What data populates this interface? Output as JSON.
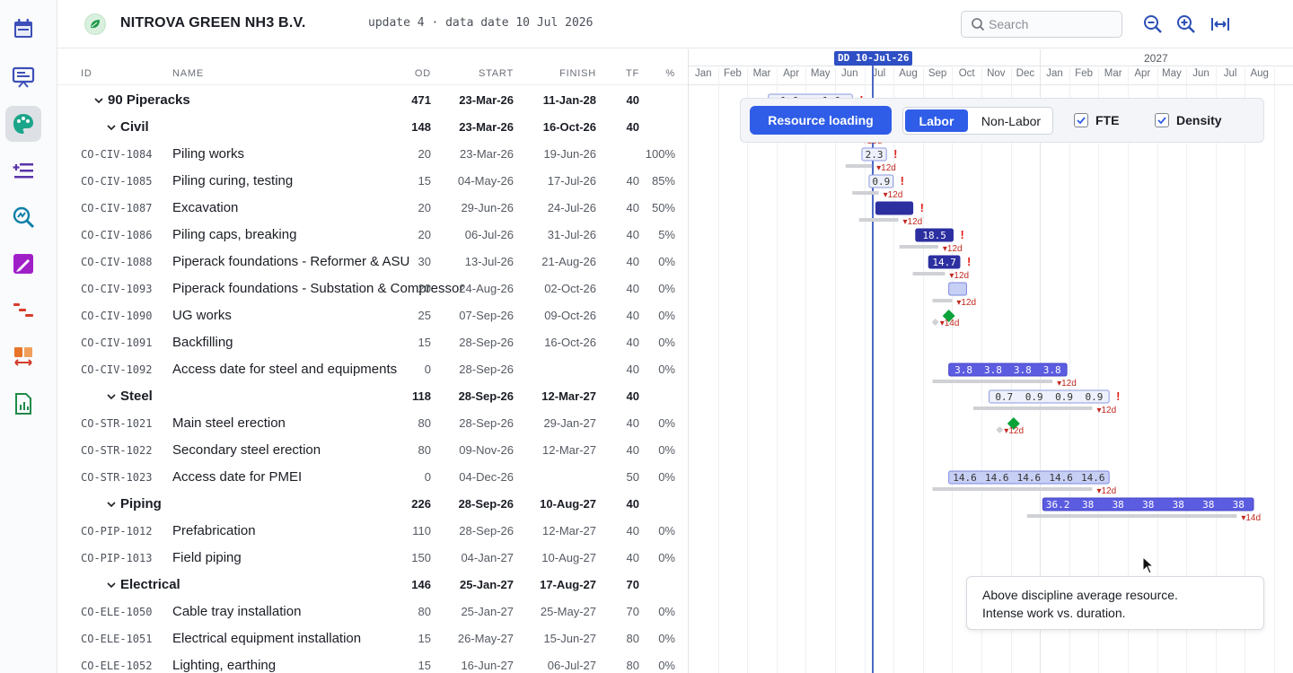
{
  "sidebar": {
    "items": [
      {
        "icon": "calendar-icon",
        "color": "#3d4fb8"
      },
      {
        "icon": "presentation-icon",
        "color": "#3d4fb8"
      },
      {
        "icon": "palette-icon",
        "color": "#1ba58a",
        "active": true
      },
      {
        "icon": "list-plus-icon",
        "color": "#5a34a8"
      },
      {
        "icon": "zoom-analysis-icon",
        "color": "#0f7fa8"
      },
      {
        "icon": "pen-icon",
        "color": "#a020c8"
      },
      {
        "icon": "bars-cascade-icon",
        "color": "#d63c2a"
      },
      {
        "icon": "swap-blocks-icon",
        "color": "#e8742a"
      },
      {
        "icon": "report-chart-icon",
        "color": "#1f8a4a"
      }
    ]
  },
  "header": {
    "company": "NITROVA GREEN NH3 B.V.",
    "update": "update 4 · data date 10 Jul 2026",
    "search_placeholder": "Search"
  },
  "table": {
    "columns": {
      "id": "ID",
      "name": "NAME",
      "od": "OD",
      "start": "START",
      "finish": "FINISH",
      "tf": "TF",
      "pct": "%"
    },
    "rows": [
      {
        "level": 0,
        "group": true,
        "id": "",
        "name": "90 Piperacks",
        "od": "471",
        "start": "23-Mar-26",
        "finish": "11-Jan-28",
        "tf": "40",
        "pct": ""
      },
      {
        "level": 1,
        "group": true,
        "id": "",
        "name": "Civil",
        "od": "148",
        "start": "23-Mar-26",
        "finish": "16-Oct-26",
        "tf": "40",
        "pct": ""
      },
      {
        "group": false,
        "id": "CO-CIV-1084",
        "name": "Piling works",
        "od": "20",
        "start": "23-Mar-26",
        "finish": "19-Jun-26",
        "tf": "",
        "pct": "100%"
      },
      {
        "group": false,
        "id": "CO-CIV-1085",
        "name": "Piling curing, testing",
        "od": "15",
        "start": "04-May-26",
        "finish": "17-Jul-26",
        "tf": "40",
        "pct": "85%"
      },
      {
        "group": false,
        "id": "CO-CIV-1087",
        "name": "Excavation",
        "od": "20",
        "start": "29-Jun-26",
        "finish": "24-Jul-26",
        "tf": "40",
        "pct": "50%"
      },
      {
        "group": false,
        "id": "CO-CIV-1086",
        "name": "Piling caps, breaking",
        "od": "20",
        "start": "06-Jul-26",
        "finish": "31-Jul-26",
        "tf": "40",
        "pct": "5%"
      },
      {
        "group": false,
        "id": "CO-CIV-1088",
        "name": "Piperack foundations - Reformer & ASU",
        "od": "30",
        "start": "13-Jul-26",
        "finish": "21-Aug-26",
        "tf": "40",
        "pct": "0%"
      },
      {
        "group": false,
        "id": "CO-CIV-1093",
        "name": "Piperack foundations - Substation & Compressor",
        "od": "20",
        "start": "24-Aug-26",
        "finish": "02-Oct-26",
        "tf": "40",
        "pct": "0%"
      },
      {
        "group": false,
        "id": "CO-CIV-1090",
        "name": "UG works",
        "od": "25",
        "start": "07-Sep-26",
        "finish": "09-Oct-26",
        "tf": "40",
        "pct": "0%"
      },
      {
        "group": false,
        "id": "CO-CIV-1091",
        "name": "Backfilling",
        "od": "15",
        "start": "28-Sep-26",
        "finish": "16-Oct-26",
        "tf": "40",
        "pct": "0%"
      },
      {
        "group": false,
        "id": "CO-CIV-1092",
        "name": "Access date for steel and equipments",
        "od": "0",
        "start": "28-Sep-26",
        "finish": "",
        "tf": "40",
        "pct": "0%"
      },
      {
        "level": 1,
        "group": true,
        "id": "",
        "name": "Steel",
        "od": "118",
        "start": "28-Sep-26",
        "finish": "12-Mar-27",
        "tf": "40",
        "pct": ""
      },
      {
        "group": false,
        "id": "CO-STR-1021",
        "name": "Main steel erection",
        "od": "80",
        "start": "28-Sep-26",
        "finish": "29-Jan-27",
        "tf": "40",
        "pct": "0%"
      },
      {
        "group": false,
        "id": "CO-STR-1022",
        "name": "Secondary steel erection",
        "od": "80",
        "start": "09-Nov-26",
        "finish": "12-Mar-27",
        "tf": "40",
        "pct": "0%"
      },
      {
        "group": false,
        "id": "CO-STR-1023",
        "name": "Access date for PMEI",
        "od": "0",
        "start": "04-Dec-26",
        "finish": "",
        "tf": "50",
        "pct": "0%"
      },
      {
        "level": 1,
        "group": true,
        "id": "",
        "name": "Piping",
        "od": "226",
        "start": "28-Sep-26",
        "finish": "10-Aug-27",
        "tf": "40",
        "pct": ""
      },
      {
        "group": false,
        "id": "CO-PIP-1012",
        "name": "Prefabrication",
        "od": "110",
        "start": "28-Sep-26",
        "finish": "12-Mar-27",
        "tf": "40",
        "pct": "0%"
      },
      {
        "group": false,
        "id": "CO-PIP-1013",
        "name": "Field piping",
        "od": "150",
        "start": "04-Jan-27",
        "finish": "10-Aug-27",
        "tf": "40",
        "pct": "0%"
      },
      {
        "level": 1,
        "group": true,
        "id": "",
        "name": "Electrical",
        "od": "146",
        "start": "25-Jan-27",
        "finish": "17-Aug-27",
        "tf": "70",
        "pct": ""
      },
      {
        "group": false,
        "id": "CO-ELE-1050",
        "name": "Cable tray installation",
        "od": "80",
        "start": "25-Jan-27",
        "finish": "25-May-27",
        "tf": "70",
        "pct": "0%"
      },
      {
        "group": false,
        "id": "CO-ELE-1051",
        "name": "Electrical equipment installation",
        "od": "15",
        "start": "26-May-27",
        "finish": "15-Jun-27",
        "tf": "80",
        "pct": "0%"
      },
      {
        "group": false,
        "id": "CO-ELE-1052",
        "name": "Lighting, earthing",
        "od": "15",
        "start": "16-Jun-27",
        "finish": "06-Jul-27",
        "tf": "80",
        "pct": "0%"
      }
    ]
  },
  "gantt": {
    "year_2026": "",
    "year_2027": "2027",
    "months": [
      "Jan",
      "Feb",
      "Mar",
      "Apr",
      "May",
      "Jun",
      "Jul",
      "Aug",
      "Sep",
      "Oct",
      "Nov",
      "Dec",
      "Jan",
      "Feb",
      "Mar",
      "Apr",
      "May",
      "Jun",
      "Jul",
      "Aug"
    ],
    "data_date_label": "DD 10-Jul-26",
    "toolbar": {
      "resource_loading": "Resource loading",
      "labor": "Labor",
      "non_labor": "Non-Labor",
      "fte": "FTE",
      "density": "Density",
      "fte_checked": true,
      "density_checked": true
    },
    "tooltip_line1": "Above discipline average resource.",
    "tooltip_line2": "Intense work vs. duration.",
    "colors": {
      "light": "#eef1fb",
      "mid": "#c7cff5",
      "dark": "#2c2fa0",
      "bright": "#5b5ce0",
      "done": "#0aa33a",
      "baseline": "#cfd1d5",
      "float": "#c0281f"
    },
    "bars": [
      {
        "start": "23-Mar-26",
        "finish": "19-Jun-26",
        "kind": "light",
        "labels": [
          "1.6",
          "1.6"
        ],
        "warn": true,
        "baseline_start": "04-May-26",
        "baseline_finish": "30-May-26",
        "float": "▾7d"
      },
      {
        "start": "04-May-26",
        "finish": "17-Jul-26",
        "kind": "done",
        "labels": [],
        "warn": false,
        "baseline_start": "05-Jun-26",
        "baseline_finish": "25-Jun-26",
        "float": "▾15d"
      },
      {
        "start": "29-Jun-26",
        "finish": "24-Jul-26",
        "kind": "light",
        "labels": [
          "2.3"
        ],
        "warn": true,
        "baseline_start": "12-Jun-26",
        "baseline_finish": "09-Jul-26",
        "float": "▾12d"
      },
      {
        "start": "06-Jul-26",
        "finish": "31-Jul-26",
        "kind": "light",
        "labels": [
          "0.9"
        ],
        "warn": true,
        "baseline_start": "19-Jun-26",
        "baseline_finish": "16-Jul-26",
        "float": "▾12d"
      },
      {
        "start": "13-Jul-26",
        "finish": "21-Aug-26",
        "kind": "dark",
        "labels": [],
        "warn": true,
        "baseline_start": "26-Jun-26",
        "baseline_finish": "06-Aug-26",
        "float": "▾12d"
      },
      {
        "start": "24-Aug-26",
        "finish": "02-Oct-26",
        "kind": "dark",
        "labels": [
          "18.5"
        ],
        "warn": true,
        "baseline_start": "07-Aug-26",
        "baseline_finish": "17-Sep-26",
        "float": "▾12d"
      },
      {
        "start": "07-Sep-26",
        "finish": "09-Oct-26",
        "kind": "dark",
        "labels": [
          "14.7"
        ],
        "warn": true,
        "baseline_start": "21-Aug-26",
        "baseline_finish": "24-Sep-26",
        "float": "▾12d"
      },
      {
        "start": "28-Sep-26",
        "finish": "16-Oct-26",
        "kind": "mid",
        "labels": [],
        "warn": false,
        "baseline_start": "11-Sep-26",
        "baseline_finish": "01-Oct-26",
        "float": "▾12d"
      },
      {
        "start": "28-Sep-26",
        "finish": "",
        "kind": "milestone",
        "labels": [],
        "warn": false,
        "baseline_start": "14-Sep-26",
        "baseline_finish": "",
        "float": "▾14d"
      },
      null,
      {
        "start": "28-Sep-26",
        "finish": "29-Jan-27",
        "kind": "bright",
        "labels": [
          "3.8",
          "3.8",
          "3.8",
          "3.8"
        ],
        "warn": false,
        "baseline_start": "11-Sep-26",
        "baseline_finish": "14-Jan-27",
        "float": "▾12d"
      },
      {
        "start": "09-Nov-26",
        "finish": "12-Mar-27",
        "kind": "light",
        "labels": [
          "0.7",
          "0.9",
          "0.9",
          "0.9"
        ],
        "warn": true,
        "baseline_start": "23-Oct-26",
        "baseline_finish": "25-Feb-27",
        "float": "▾12d"
      },
      {
        "start": "04-Dec-26",
        "finish": "",
        "kind": "milestone",
        "labels": [],
        "warn": false,
        "baseline_start": "20-Nov-26",
        "baseline_finish": "",
        "float": "▾12d"
      },
      null,
      {
        "start": "28-Sep-26",
        "finish": "12-Mar-27",
        "kind": "mid",
        "labels": [
          "14.6",
          "14.6",
          "14.6",
          "14.6",
          "14.6"
        ],
        "warn": false,
        "baseline_start": "11-Sep-26",
        "baseline_finish": "25-Feb-27",
        "float": "▾12d"
      },
      {
        "start": "04-Jan-27",
        "finish": "10-Aug-27",
        "kind": "bright",
        "labels": [
          "36.2",
          "38",
          "38",
          "38",
          "38",
          "38",
          "38"
        ],
        "warn": false,
        "baseline_start": "18-Dec-26",
        "baseline_finish": "23-Jul-27",
        "float": "▾14d"
      },
      null,
      {
        "start": "25-Jan-27",
        "finish": "25-May-27",
        "kind": "hidden",
        "labels": [],
        "warn": false
      },
      {
        "start": "26-May-27",
        "finish": "15-Jun-27",
        "kind": "mid",
        "labels": [],
        "warn": false,
        "baseline_start": "15-May-27",
        "baseline_finish": "03-Jun-27",
        "float": "▾14d"
      },
      {
        "start": "16-Jun-27",
        "finish": "06-Jul-27",
        "kind": "light",
        "labels": [],
        "warn": true,
        "baseline_start": "",
        "baseline_finish": "",
        "float": ""
      }
    ]
  }
}
